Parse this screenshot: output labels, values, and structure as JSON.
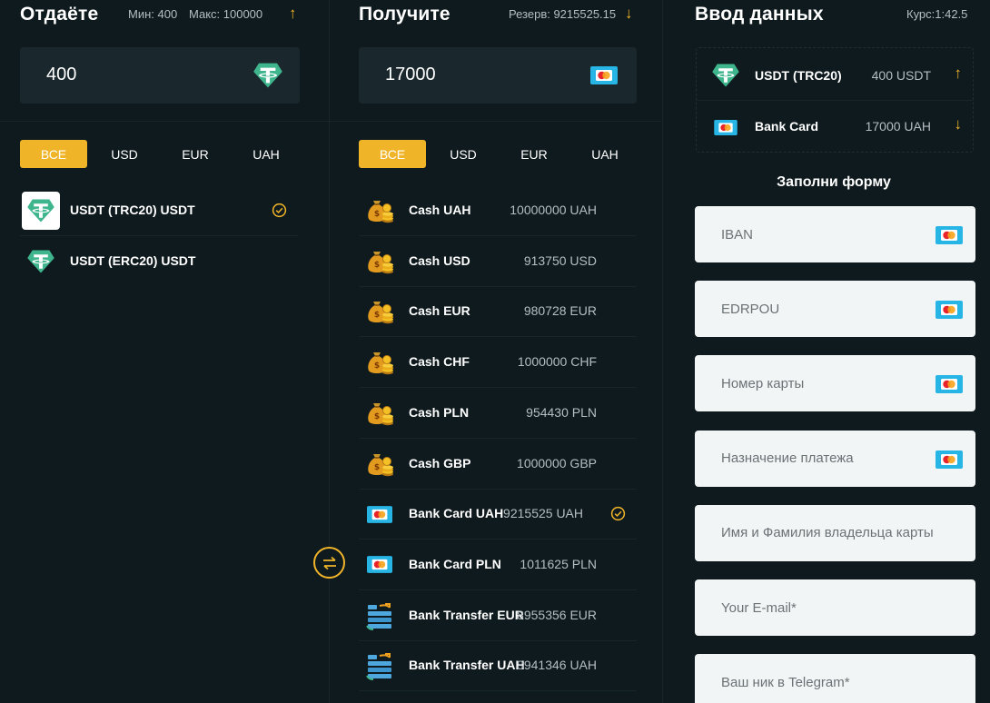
{
  "give": {
    "title": "Отдаёте",
    "min_label": "Мин: 400",
    "max_label": "Макс: 100000",
    "amount": "400",
    "tabs": [
      "ВСЕ",
      "USD",
      "EUR",
      "UAH"
    ],
    "items": [
      {
        "name": "USDT (TRC20) USDT",
        "selected": true
      },
      {
        "name": "USDT (ERC20) USDT",
        "selected": false
      }
    ]
  },
  "get": {
    "title": "Получите",
    "reserve_label": "Резерв: 9215525.15",
    "amount": "17000",
    "tabs": [
      "ВСЕ",
      "USD",
      "EUR",
      "UAH"
    ],
    "items": [
      {
        "name": "Cash UAH",
        "amount": "10000000 UAH",
        "icon": "money-bag-icon"
      },
      {
        "name": "Cash USD",
        "amount": "913750 USD",
        "icon": "money-bag-icon"
      },
      {
        "name": "Cash EUR",
        "amount": "980728 EUR",
        "icon": "money-bag-icon"
      },
      {
        "name": "Cash CHF",
        "amount": "1000000 CHF",
        "icon": "money-bag-icon"
      },
      {
        "name": "Cash PLN",
        "amount": "954430 PLN",
        "icon": "money-bag-icon"
      },
      {
        "name": "Cash GBP",
        "amount": "1000000 GBP",
        "icon": "money-bag-icon"
      },
      {
        "name": "Bank Card UAH",
        "amount": "9215525 UAH",
        "icon": "bank-card-icon",
        "selected": true
      },
      {
        "name": "Bank Card PLN",
        "amount": "1011625 PLN",
        "icon": "bank-card-icon"
      },
      {
        "name": "Bank Transfer EUR",
        "amount": "8955356 EUR",
        "icon": "bank-transfer-icon"
      },
      {
        "name": "Bank Transfer UAH",
        "amount": "8941346 UAH",
        "icon": "bank-transfer-icon"
      }
    ]
  },
  "data_entry": {
    "title": "Ввод данных",
    "rate_label": "Курс:1:42.5",
    "summary": [
      {
        "name": "USDT (TRC20)",
        "amount": "400 USDT",
        "direction": "up"
      },
      {
        "name": "Bank Card",
        "amount": "17000 UAH",
        "direction": "down"
      }
    ],
    "form_title": "Заполни форму",
    "fields": [
      {
        "placeholder": "IBAN",
        "icon": true
      },
      {
        "placeholder": "EDRPOU",
        "icon": true
      },
      {
        "placeholder": "Номер карты",
        "icon": true
      },
      {
        "placeholder": "Назначение платежа",
        "icon": true
      },
      {
        "placeholder": "Имя и Фамилия владельца карты",
        "icon": false
      },
      {
        "placeholder": "Your E-mail*",
        "icon": false
      },
      {
        "placeholder": "Ваш ник в Telegram*",
        "icon": false
      }
    ]
  },
  "colors": {
    "background": "#0f1a1e",
    "panel": "#1a282d",
    "accent": "#f0b429",
    "tether_green": "#3fb58e",
    "field_bg": "#f2f5f6"
  }
}
